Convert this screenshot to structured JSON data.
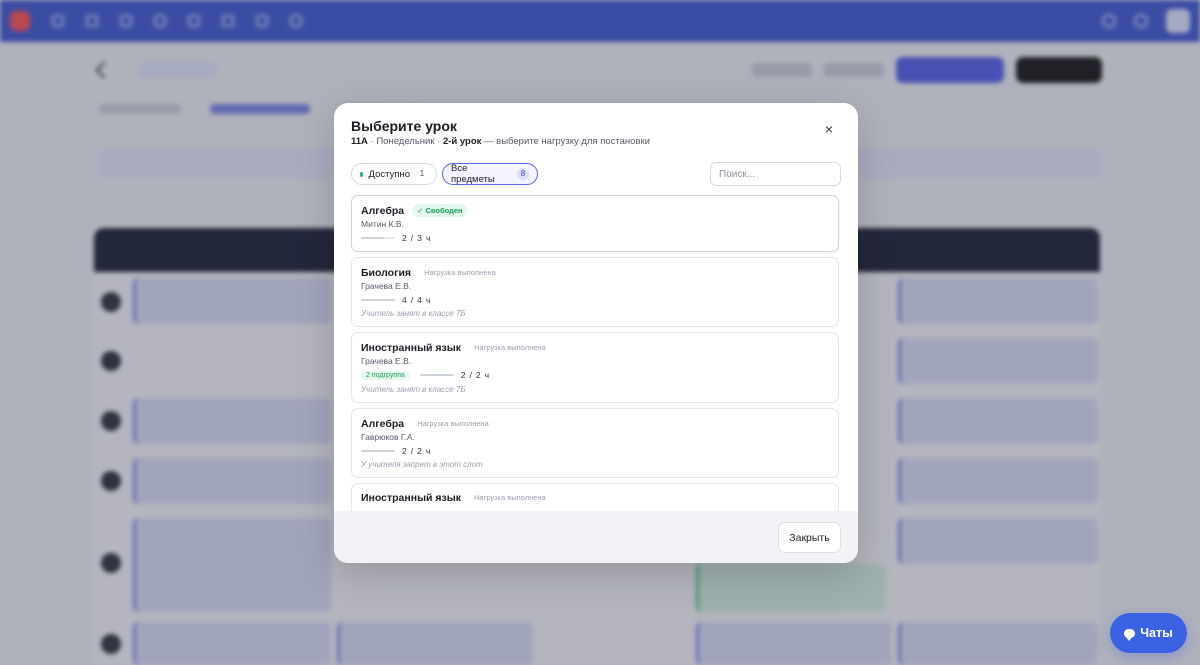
{
  "modal": {
    "title": "Выберите урок",
    "subtitle": {
      "class_name": "11А",
      "sep1": " · Понедельник · ",
      "lesson": "2-й урок",
      "rest": " — выберите нагрузку для постановки"
    },
    "close_icon": "×",
    "filters": [
      {
        "label": "Доступно",
        "count": "1",
        "active": false
      },
      {
        "label": "Все предметы",
        "count": "8",
        "active": true
      }
    ],
    "search": {
      "placeholder": "Поиск...",
      "value": ""
    },
    "cards": [
      {
        "subject": "Алгебра",
        "status": "✓ Свободен",
        "status_type": "free",
        "teacher": "Митин К.В.",
        "done": "2",
        "total": "3",
        "unit": "ч",
        "subgroup": "",
        "note": "",
        "progress": 0.67
      },
      {
        "subject": "Биология",
        "status": "Нагрузка выполнена",
        "status_type": "done",
        "teacher": "Грачева Е.В.",
        "done": "4",
        "total": "4",
        "unit": "ч",
        "subgroup": "",
        "note": "Учитель занят в классе 7Б",
        "progress": 1.0
      },
      {
        "subject": "Иностранный язык",
        "status": "Нагрузка выполнена",
        "status_type": "done",
        "teacher": "Грачева Е.В.",
        "done": "2",
        "total": "2",
        "unit": "ч",
        "subgroup": "2 подгруппа",
        "note": "Учитель занят в классе 7Б",
        "progress": 1.0
      },
      {
        "subject": "Алгебра",
        "status": "Нагрузка выполнена",
        "status_type": "done",
        "teacher": "Гаврюков Г.А.",
        "done": "2",
        "total": "2",
        "unit": "ч",
        "subgroup": "",
        "note": "У учителя запрет в этот слот",
        "progress": 1.0
      },
      {
        "subject": "Иностранный язык",
        "status": "Нагрузка выполнена",
        "status_type": "done",
        "teacher": "",
        "done": "",
        "total": "",
        "unit": "",
        "subgroup": "",
        "note": "",
        "progress": 1.0
      }
    ],
    "footer_button": "Закрыть"
  },
  "chat_button": {
    "label": "Чаты",
    "icon": "chat-bubble-icon"
  },
  "colors": {
    "accent": "#5b63e0",
    "free_green": "#1c9f5a",
    "chat_blue": "#3b62e3",
    "topbar": "#3b54d1"
  }
}
